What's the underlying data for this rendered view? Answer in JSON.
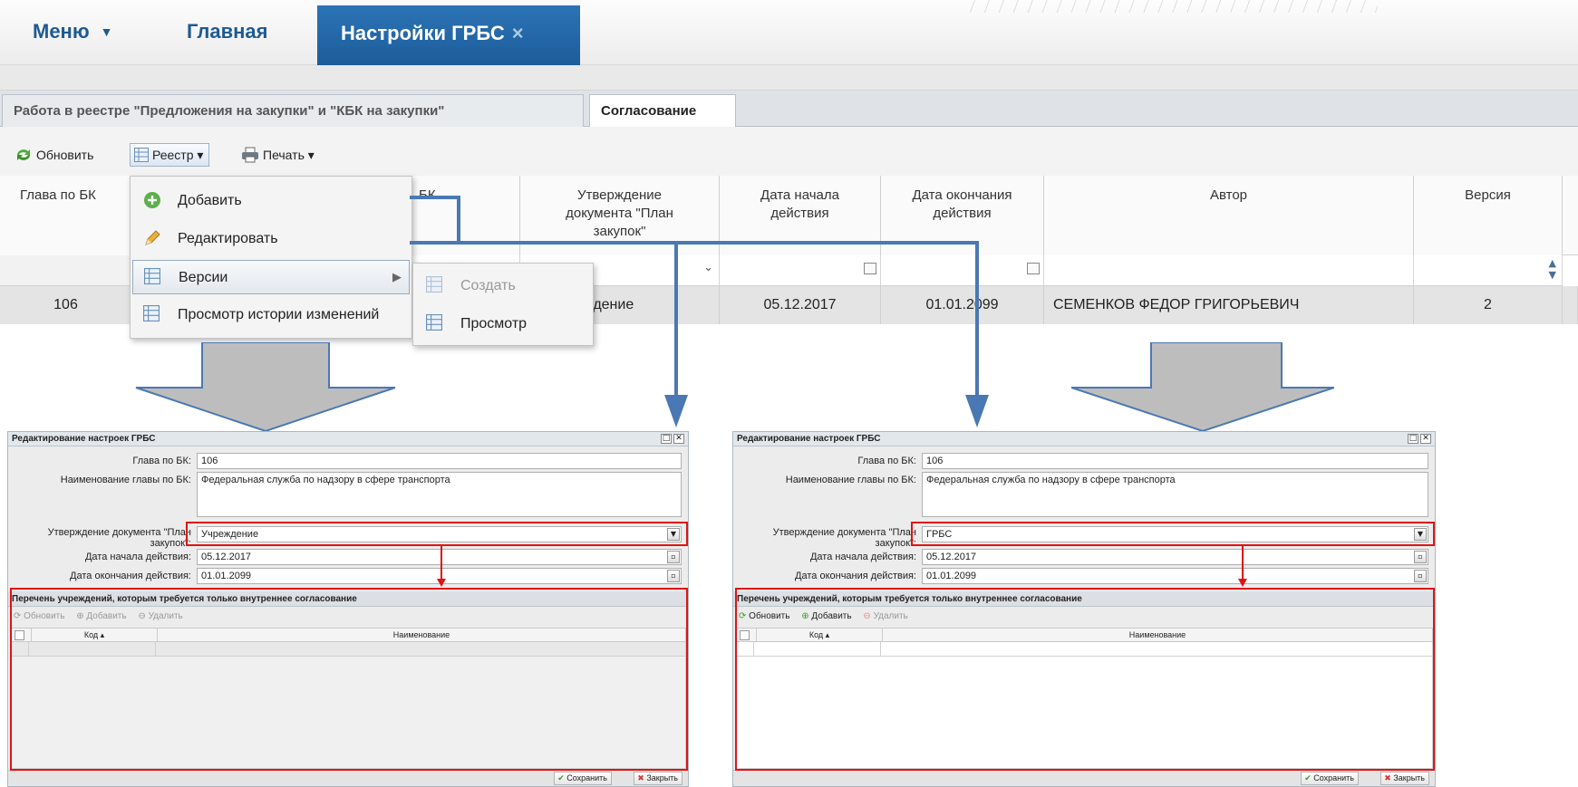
{
  "topnav": {
    "menu_label": "Меню",
    "home_label": "Главная",
    "active_tab_label": "Настройки ГРБС",
    "close_glyph": "×",
    "caret_glyph": "▼"
  },
  "subtabs": {
    "work_label": "Работа в реестре \"Предложения на закупки\" и \"КБК на закупки\"",
    "approve_label": "Согласование"
  },
  "toolbar": {
    "refresh_label": "Обновить",
    "registry_label": "Реестр",
    "print_label": "Печать",
    "caret_glyph": "▾"
  },
  "grid": {
    "columns": {
      "glava": "Глава по БК",
      "name_partial": "БК",
      "approval": "Утверждение документа \"План закупок\"",
      "date_start": "Дата начала действия",
      "date_end": "Дата окончания действия",
      "author": "Автор",
      "version": "Версия"
    },
    "row": {
      "glava": "106",
      "approval_partial": "реждение",
      "date_start": "05.12.2017",
      "date_end": "01.01.2099",
      "author": "СЕМЕНКОВ ФЕДОР ГРИГОРЬЕВИЧ",
      "version": "2"
    }
  },
  "context_menu": {
    "add": "Добавить",
    "edit": "Редактировать",
    "versions": "Версии",
    "history": "Просмотр истории изменений",
    "submenu_create": "Создать",
    "submenu_view": "Просмотр"
  },
  "dialogs": {
    "left": {
      "title": "Редактирование настроек ГРБС",
      "glava_label": "Глава по БК:",
      "glava_value": "106",
      "name_label": "Наименование главы по БК:",
      "name_value": "Федеральная служба по надзору в сфере транспорта",
      "approval_label_line1": "Утверждение документа \"План",
      "approval_label_line2": "закупок\":",
      "approval_value": "Учреждение",
      "start_label": "Дата начала действия:",
      "start_value": "05.12.2017",
      "end_label": "Дата окончания действия:",
      "end_value": "01.01.2099",
      "section_title": "Перечень учреждений, которым требуется только внутреннее согласование",
      "btn_refresh": "Обновить",
      "btn_add": "Добавить",
      "btn_delete": "Удалить",
      "col_code": "Код",
      "col_name": "Наименование",
      "save_label": "Сохранить",
      "close_label": "Закрыть"
    },
    "right": {
      "title": "Редактирование настроек ГРБС",
      "glava_label": "Глава по БК:",
      "glava_value": "106",
      "name_label": "Наименование главы по БК:",
      "name_value": "Федеральная служба по надзору в сфере транспорта",
      "approval_label_line1": "Утверждение документа \"План",
      "approval_label_line2": "закупок\":",
      "approval_value": "ГРБС",
      "start_label": "Дата начала действия:",
      "start_value": "05.12.2017",
      "end_label": "Дата окончания действия:",
      "end_value": "01.01.2099",
      "section_title": "Перечень учреждений, которым требуется только внутреннее согласование",
      "btn_refresh": "Обновить",
      "btn_add": "Добавить",
      "btn_delete": "Удалить",
      "col_code": "Код",
      "col_name": "Наименование",
      "save_label": "Сохранить",
      "close_label": "Закрыть"
    }
  },
  "colors": {
    "accent_blue": "#1d5a94",
    "annotation_red": "#e01313",
    "connector_blue": "#4a78b4",
    "big_arrow_gray": "#bdbdbd"
  }
}
